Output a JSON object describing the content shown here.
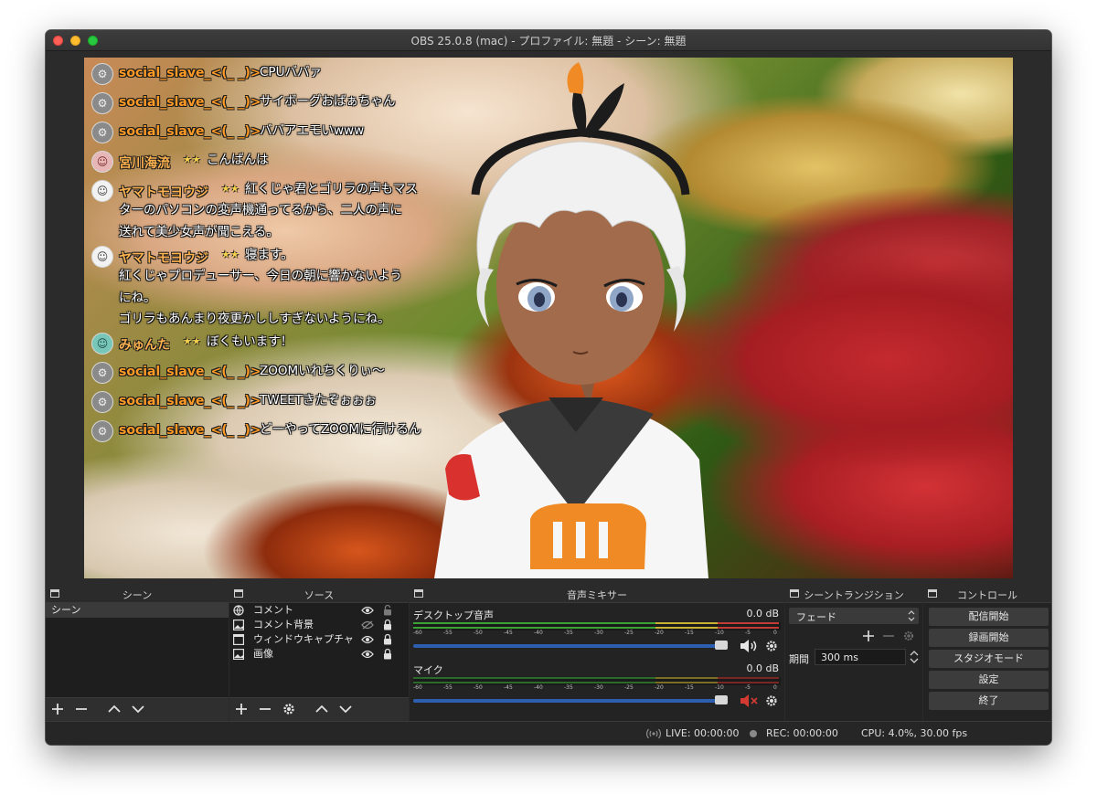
{
  "window": {
    "title": "OBS 25.0.8 (mac) - プロファイル: 無題 - シーン: 無題"
  },
  "chat": [
    {
      "user": "social_slave_<(_ _)>",
      "stars": "",
      "lines": [
        "CPUババァ"
      ],
      "avatar_icon": "gear-icon"
    },
    {
      "user": "social_slave_<(_ _)>",
      "stars": "",
      "lines": [
        "サイボーグおばぁちゃん"
      ],
      "avatar_icon": "gear-icon"
    },
    {
      "user": "social_slave_<(_ _)>",
      "stars": "",
      "lines": [
        "ババアエモいwww"
      ],
      "avatar_icon": "gear-icon"
    },
    {
      "user": "宮川海流",
      "stars": "★★",
      "lines": [
        "こんばんは"
      ],
      "avatar_icon": "user-icon"
    },
    {
      "user": "ヤマトモヨウジ",
      "stars": "★★",
      "lines": [
        "紅くじゃ君とゴリラの声もマス",
        "ターのパソコンの変声機通ってるから、二人の声に",
        "送れて美少女声が聞こえる。"
      ],
      "avatar_icon": "user-icon"
    },
    {
      "user": "ヤマトモヨウジ",
      "stars": "★★",
      "lines": [
        "寝ます。",
        "紅くじゃプロデューサー、今日の朝に響かないよう",
        "にね。",
        "ゴリラもあんまり夜更かししすぎないようにね。"
      ],
      "avatar_icon": "user-icon"
    },
    {
      "user": "みゅんた",
      "stars": "★★",
      "lines": [
        "ぼくもいます！"
      ],
      "avatar_icon": "user-icon"
    },
    {
      "user": "social_slave_<(_ _)>",
      "stars": "",
      "lines": [
        "ZOOMいれちくりぃ〜"
      ],
      "avatar_icon": "gear-icon"
    },
    {
      "user": "social_slave_<(_ _)>",
      "stars": "",
      "lines": [
        "TWEETきたぞぉぉぉ"
      ],
      "avatar_icon": "gear-icon"
    },
    {
      "user": "social_slave_<(_ _)>",
      "stars": "",
      "lines": [
        "どーやってZOOMに行けるん"
      ],
      "avatar_icon": "gear-icon"
    }
  ],
  "panels": {
    "scenes": {
      "title": "シーン",
      "items": [
        "シーン"
      ]
    },
    "sources": {
      "title": "ソース",
      "items": [
        {
          "label": "コメント",
          "icon": "browser-icon",
          "visible": true,
          "locked": false
        },
        {
          "label": "コメント背景",
          "icon": "image-icon",
          "visible": false,
          "locked": true
        },
        {
          "label": "ウィンドウキャプチャ",
          "icon": "window-capture-icon",
          "visible": true,
          "locked": true
        },
        {
          "label": "画像",
          "icon": "image-icon",
          "visible": true,
          "locked": true
        }
      ]
    },
    "mixer": {
      "title": "音声ミキサー",
      "channels": [
        {
          "name": "デスクトップ音声",
          "db": "0.0 dB",
          "muted": false,
          "volume": 1.0
        },
        {
          "name": "マイク",
          "db": "0.0 dB",
          "muted": true,
          "volume": 1.0
        }
      ],
      "ticks": [
        "-60",
        "-55",
        "-50",
        "-45",
        "-40",
        "-35",
        "-30",
        "-25",
        "-20",
        "-15",
        "-10",
        "-5",
        "0"
      ]
    },
    "transitions": {
      "title": "シーントランジション",
      "selected": "フェード",
      "duration_label": "期間",
      "duration": "300 ms"
    },
    "controls": {
      "title": "コントロール",
      "buttons": [
        "配信開始",
        "録画開始",
        "スタジオモード",
        "設定",
        "終了"
      ]
    }
  },
  "status": {
    "live": "LIVE: 00:00:00",
    "rec": "REC: 00:00:00",
    "cpu": "CPU: 4.0%, 30.00 fps"
  },
  "colors": {
    "username": "#ff9a26",
    "meter_green": "#3aa335",
    "meter_yellow": "#c9b233",
    "meter_red": "#c23b34",
    "volume": "#2d5fb0"
  }
}
